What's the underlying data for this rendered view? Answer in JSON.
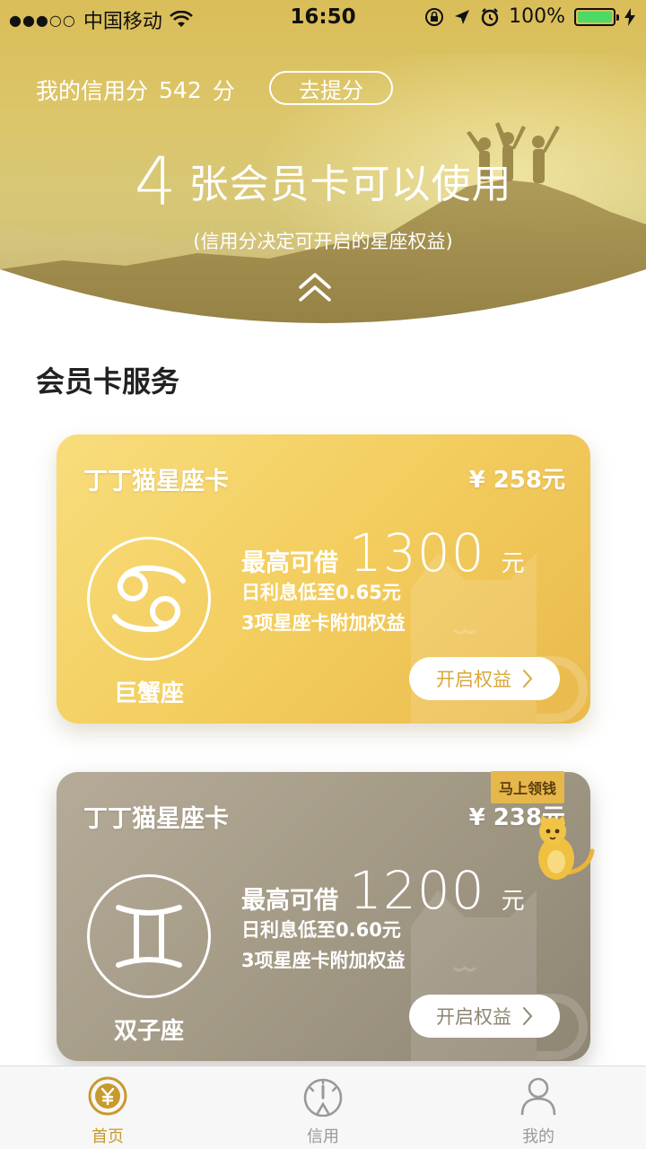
{
  "status_bar": {
    "signal_dots": "●●●○○",
    "carrier": "中国移动",
    "time": "16:50",
    "battery_percent": "100%",
    "battery_level": 1.0,
    "icons": [
      "wifi-icon",
      "orientation-lock-icon",
      "location-arrow-icon",
      "alarm-icon",
      "charging-icon"
    ]
  },
  "hero": {
    "score_label": "我的信用分",
    "score_value": "542",
    "score_unit": "分",
    "raise_button": "去提分",
    "card_count": "4",
    "headline_rest": "张会员卡可以使用",
    "subline": "(信用分决定可开启的星座权益)"
  },
  "section": {
    "title": "会员卡服务"
  },
  "cards": [
    {
      "name": "丁丁猫星座卡",
      "price": "¥ 258元",
      "zodiac": "巨蟹座",
      "zodiac_icon": "cancer-icon",
      "loan_label": "最高可借",
      "loan_amount": "1300",
      "loan_unit": "元",
      "detail_rate": "日利息低至0.65元",
      "detail_benefits": "3项星座卡附加权益",
      "button": "开启权益",
      "color": "#f3cd5e"
    },
    {
      "name": "丁丁猫星座卡",
      "price": "¥ 238元",
      "zodiac": "双子座",
      "zodiac_icon": "gemini-icon",
      "loan_label": "最高可借",
      "loan_amount": "1200",
      "loan_unit": "元",
      "detail_rate": "日利息低至0.60元",
      "detail_benefits": "3项星座卡附加权益",
      "button": "开启权益",
      "color": "#a39a86",
      "ribbon": "马上领钱"
    }
  ],
  "tabbar": {
    "items": [
      {
        "label": "首页",
        "icon": "yen-coin-icon",
        "active": true
      },
      {
        "label": "信用",
        "icon": "gauge-icon",
        "active": false
      },
      {
        "label": "我的",
        "icon": "person-icon",
        "active": false
      }
    ],
    "active_color": "#c79a2d",
    "inactive_color": "#999999"
  }
}
